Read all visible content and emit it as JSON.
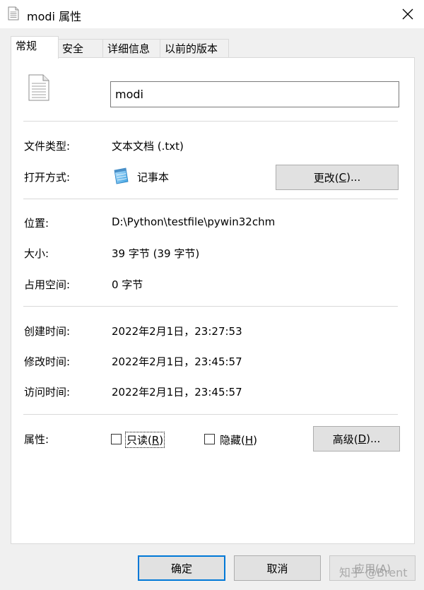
{
  "window": {
    "title": "modi 属性",
    "close_icon": "close-icon"
  },
  "tabs": [
    {
      "label": "常规",
      "active": true
    },
    {
      "label": "安全",
      "active": false
    },
    {
      "label": "详细信息",
      "active": false
    },
    {
      "label": "以前的版本",
      "active": false
    }
  ],
  "general": {
    "file_name": "modi",
    "file_type_label": "文件类型:",
    "file_type_value": "文本文档 (.txt)",
    "opens_with_label": "打开方式:",
    "opens_with_value": "记事本",
    "change_button": {
      "label": "更改(",
      "hotkey": "C",
      "suffix": ")..."
    },
    "location_label": "位置:",
    "location_value": "D:\\Python\\testfile\\pywin32chm",
    "size_label": "大小:",
    "size_value": "39 字节 (39 字节)",
    "size_on_disk_label": "占用空间:",
    "size_on_disk_value": "0 字节",
    "created_label": "创建时间:",
    "created_value": "2022年2月1日，23:27:53",
    "modified_label": "修改时间:",
    "modified_value": "2022年2月1日，23:45:57",
    "accessed_label": "访问时间:",
    "accessed_value": "2022年2月1日，23:45:57",
    "attributes_label": "属性:",
    "readonly": {
      "label": "只读(",
      "hotkey": "R",
      "suffix": ")",
      "checked": false
    },
    "hidden": {
      "label": "隐藏(",
      "hotkey": "H",
      "suffix": ")",
      "checked": false
    },
    "advanced_button": {
      "label": "高级(",
      "hotkey": "D",
      "suffix": ")..."
    }
  },
  "footer": {
    "ok": "确定",
    "cancel": "取消",
    "apply": "应用(A)"
  },
  "watermark": "知乎 @Brent",
  "colors": {
    "accent": "#0078d7",
    "button": "#e1e1e1",
    "panel": "#ffffff",
    "background": "#f0f0f0"
  }
}
